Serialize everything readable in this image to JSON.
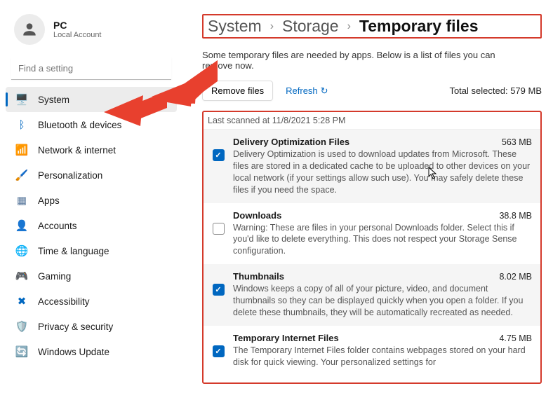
{
  "profile": {
    "name": "PC",
    "sub": "Local Account"
  },
  "search": {
    "placeholder": "Find a setting"
  },
  "nav": [
    {
      "label": "System",
      "icon": "🖥️",
      "active": true
    },
    {
      "label": "Bluetooth & devices",
      "icon": "ᛒ",
      "color": "#0067c0"
    },
    {
      "label": "Network & internet",
      "icon": "📶",
      "color": "#0067c0"
    },
    {
      "label": "Personalization",
      "icon": "🖌️",
      "color": "#b15c00"
    },
    {
      "label": "Apps",
      "icon": "▦",
      "color": "#5b7a9e"
    },
    {
      "label": "Accounts",
      "icon": "👤",
      "color": "#777"
    },
    {
      "label": "Time & language",
      "icon": "🌐",
      "color": "#0067c0"
    },
    {
      "label": "Gaming",
      "icon": "🎮",
      "color": "#888"
    },
    {
      "label": "Accessibility",
      "icon": "✖",
      "color": "#0067c0"
    },
    {
      "label": "Privacy & security",
      "icon": "🛡️",
      "color": "#888"
    },
    {
      "label": "Windows Update",
      "icon": "🔄",
      "color": "#0067c0"
    }
  ],
  "breadcrumb": {
    "a": "System",
    "b": "Storage",
    "c": "Temporary files"
  },
  "desc": "Some temporary files are needed by apps. Below is a list of files you can remove now.",
  "actions": {
    "remove": "Remove files",
    "refresh": "Refresh",
    "total_label": "Total selected:",
    "total_value": "579 MB"
  },
  "last_scanned": "Last scanned at 11/8/2021 5:28 PM",
  "files": [
    {
      "title": "Delivery Optimization Files",
      "size": "563 MB",
      "checked": true,
      "alt": true,
      "desc": "Delivery Optimization is used to download updates from Microsoft. These files are stored in a dedicated cache to be uploaded to other devices on your local network (if your settings allow such use). You may safely delete these files if you need the space."
    },
    {
      "title": "Downloads",
      "size": "38.8 MB",
      "checked": false,
      "alt": false,
      "desc": "Warning: These are files in your personal Downloads folder. Select this if you'd like to delete everything. This does not respect your Storage Sense configuration."
    },
    {
      "title": "Thumbnails",
      "size": "8.02 MB",
      "checked": true,
      "alt": true,
      "desc": "Windows keeps a copy of all of your picture, video, and document thumbnails so they can be displayed quickly when you open a folder. If you delete these thumbnails, they will be automatically recreated as needed."
    },
    {
      "title": "Temporary Internet Files",
      "size": "4.75 MB",
      "checked": true,
      "alt": false,
      "desc": "The Temporary Internet Files folder contains webpages stored on your hard disk for quick viewing. Your personalized settings for"
    }
  ]
}
